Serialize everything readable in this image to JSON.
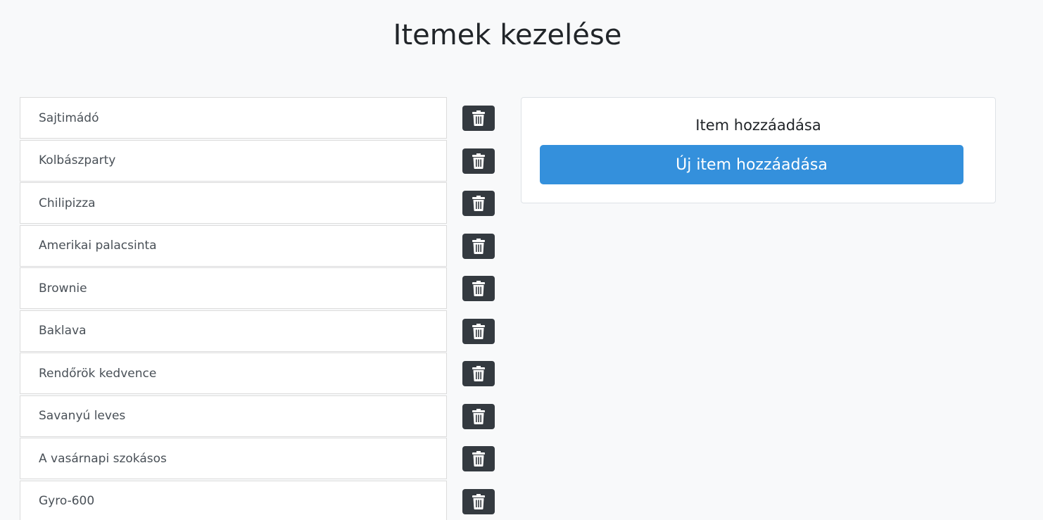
{
  "page": {
    "title": "Itemek kezelése"
  },
  "items": [
    {
      "name": "Sajtimádó",
      "delete_icon": "trash-icon"
    },
    {
      "name": "Kolbászparty",
      "delete_icon": "trash-icon"
    },
    {
      "name": "Chilipizza",
      "delete_icon": "trash-icon"
    },
    {
      "name": "Amerikai palacsinta",
      "delete_icon": "trash-icon"
    },
    {
      "name": "Brownie",
      "delete_icon": "trash-icon"
    },
    {
      "name": "Baklava",
      "delete_icon": "trash-icon"
    },
    {
      "name": "Rendőrök kedvence",
      "delete_icon": "trash-icon"
    },
    {
      "name": "Savanyú leves",
      "delete_icon": "trash-icon"
    },
    {
      "name": "A vasárnapi szokásos",
      "delete_icon": "trash-icon"
    },
    {
      "name": "Gyro-600",
      "delete_icon": "trash-icon"
    }
  ],
  "add_panel": {
    "title": "Item hozzáadása",
    "button_label": "Új item hozzáadása"
  },
  "colors": {
    "background": "#f8f9fa",
    "delete_button": "#343a40",
    "primary_button": "#3490dc"
  }
}
